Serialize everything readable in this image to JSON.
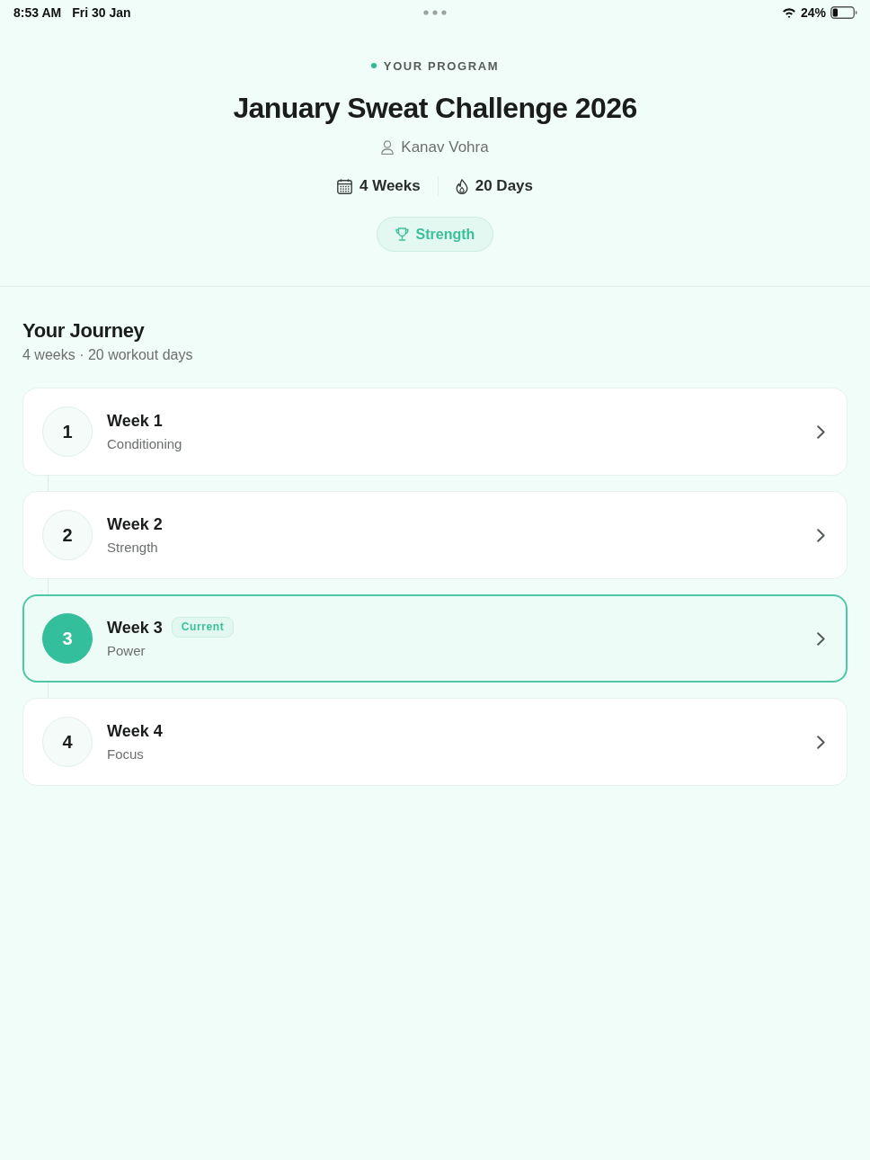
{
  "status_bar": {
    "time": "8:53 AM",
    "date": "Fri 30 Jan",
    "battery": "24%"
  },
  "header": {
    "eyebrow": "YOUR PROGRAM",
    "title": "January Sweat Challenge 2026",
    "author": "Kanav Vohra",
    "stats": [
      {
        "kind": "duration",
        "text": "4 Weeks"
      },
      {
        "kind": "days",
        "text": "20 Days"
      }
    ],
    "tag": "Strength"
  },
  "journey": {
    "title": "Your Journey",
    "subtitle": "4 weeks · 20 workout days",
    "weeks": [
      {
        "number": "1",
        "title": "Week 1",
        "subtitle": "Conditioning",
        "current": false
      },
      {
        "number": "2",
        "title": "Week 2",
        "subtitle": "Strength",
        "current": false
      },
      {
        "number": "3",
        "title": "Week 3",
        "badge": "Current",
        "subtitle": "Power",
        "current": true
      },
      {
        "number": "4",
        "title": "Week 4",
        "subtitle": "Focus",
        "current": false
      }
    ]
  }
}
